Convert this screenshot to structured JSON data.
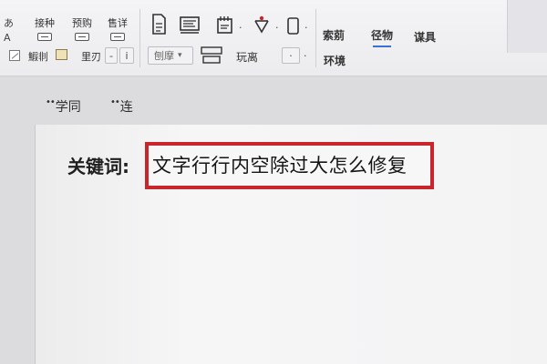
{
  "ribbon": {
    "left_col": {
      "top_glyph": "あ",
      "bottom_glyph": "A"
    },
    "group1": {
      "label": "接种"
    },
    "group2": {
      "label": "预购"
    },
    "group3": {
      "label": "售详"
    },
    "row2": {
      "item1_label": "鰕剕",
      "item2_label": "里刃",
      "stepper_minus": "-",
      "stepper_value": "ⅰ",
      "style_select": "刨摩",
      "style_arrow": "▾",
      "zoom_label": "玩离",
      "dot_select": "·"
    },
    "tabs": [
      {
        "label": "索莂"
      },
      {
        "label": "径物"
      },
      {
        "label": "谋具"
      }
    ],
    "env_label": "环境",
    "dot_marks": [
      "·",
      "·",
      "·"
    ]
  },
  "quick_access": [
    {
      "dots": "••",
      "label": "学同"
    },
    {
      "dots": "••",
      "label": "连"
    }
  ],
  "document": {
    "keyword_label": "关键词:",
    "keyword_text": "文字行行内空除过大怎么修复"
  },
  "colors": {
    "highlight_border": "#c8262c",
    "tab_underline": "#3b6fd8"
  }
}
